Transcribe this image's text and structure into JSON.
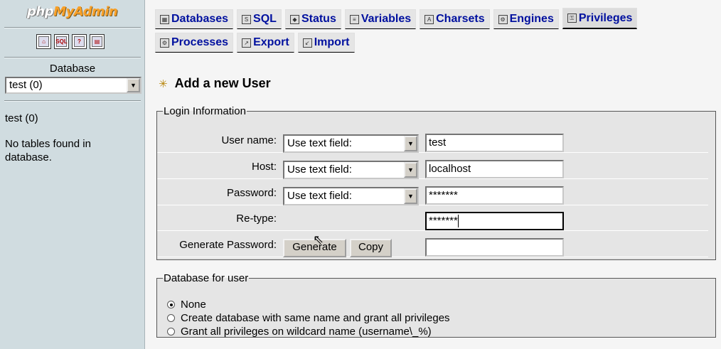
{
  "left": {
    "logo_php": "php",
    "logo_myadmin": "MyAdmin",
    "icons": [
      "home-icon",
      "sql-query-icon",
      "docs-icon",
      "docs2-icon"
    ],
    "database_label": "Database",
    "database_select": "test (0)",
    "current_db": "test (0)",
    "no_tables": "No tables found in database."
  },
  "tabs": {
    "row1": [
      {
        "label": "Databases",
        "icon": "databases-icon"
      },
      {
        "label": "SQL",
        "icon": "sql-icon"
      },
      {
        "label": "Status",
        "icon": "status-icon"
      },
      {
        "label": "Variables",
        "icon": "variables-icon"
      },
      {
        "label": "Charsets",
        "icon": "charsets-icon"
      },
      {
        "label": "Engines",
        "icon": "engines-icon"
      },
      {
        "label": "Privileges",
        "icon": "privileges-icon"
      }
    ],
    "row2": [
      {
        "label": "Processes",
        "icon": "processes-icon"
      },
      {
        "label": "Export",
        "icon": "export-icon"
      },
      {
        "label": "Import",
        "icon": "import-icon"
      }
    ]
  },
  "heading": "Add a new User",
  "login": {
    "legend": "Login Information",
    "username_label": "User name:",
    "username_mode": "Use text field:",
    "username_value": "test",
    "host_label": "Host:",
    "host_mode": "Use text field:",
    "host_value": "localhost",
    "password_label": "Password:",
    "password_mode": "Use text field:",
    "password_value": "*******",
    "retype_label": "Re-type:",
    "retype_value": "*******",
    "generate_label": "Generate Password:",
    "generate_button": "Generate",
    "copy_button": "Copy",
    "generated_value": ""
  },
  "dbuser": {
    "legend": "Database for user",
    "options": [
      "None",
      "Create database with same name and grant all privileges",
      "Grant all privileges on wildcard name (username\\_%)"
    ],
    "selected": "None"
  }
}
